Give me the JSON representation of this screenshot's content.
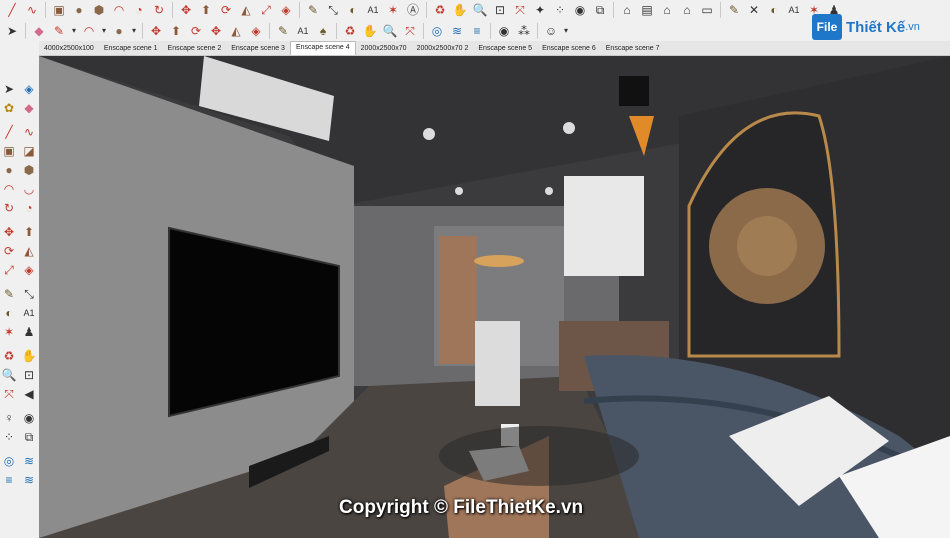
{
  "scene_tabs": [
    {
      "label": "4000x2500x100"
    },
    {
      "label": "Enscape scene 1"
    },
    {
      "label": "Enscape scene 2"
    },
    {
      "label": "Enscape scene 3"
    },
    {
      "label": "Enscape scene 4"
    },
    {
      "label": "2000x2500x70"
    },
    {
      "label": "2000x2500x70 2"
    },
    {
      "label": "Enscape scene 5"
    },
    {
      "label": "Enscape scene 6"
    },
    {
      "label": "Enscape scene 7"
    }
  ],
  "active_scene": "Enscape scene 4",
  "logo": {
    "mark": "File",
    "name": "Thiết Kế",
    "tld": ".vn"
  },
  "watermark": "Copyright © FileThietKe.vn",
  "colors": {
    "accent": "#1f77c9",
    "sketchup_red": "#c0392b",
    "wall": "#8c8c8c",
    "ceiling": "#333336",
    "floor": "#4a4541",
    "wood": "#a0765a"
  },
  "icons": {
    "toolbar_row1": [
      "line-icon",
      "freehand-icon",
      "rectangle-icon",
      "circle-icon",
      "polygon-icon",
      "arc-icon",
      "pie-icon",
      "move-icon",
      "pushpull-icon",
      "rotate-icon",
      "followme-icon",
      "scale-icon",
      "offset-icon",
      "tape-icon",
      "dimension-icon",
      "protractor-icon",
      "text-icon",
      "axes-icon",
      "3dtext-icon",
      "orbit-icon",
      "pan-icon",
      "zoom-icon",
      "zoom-window-icon",
      "zoom-extents-icon",
      "position-camera-icon",
      "walk-icon",
      "lookaround-icon",
      "section-icon",
      "warehouse-icon",
      "extension-icon",
      "home-icon",
      "house-icon",
      "component-icon",
      "paint-icon",
      "pencil-icon",
      "erase-icon",
      "chart-icon"
    ],
    "toolbar_row2": [
      "select-icon",
      "eraser-icon",
      "pencil-icon",
      "shape-icon",
      "arc-icon",
      "circle-icon",
      "polygon-icon",
      "rotate-icon",
      "move-icon",
      "pushpull-icon",
      "scale-icon",
      "followme-icon",
      "tape-icon",
      "text-icon",
      "paint-icon",
      "orbit-icon",
      "pan-icon",
      "zoom-icon",
      "zoom-extents-icon",
      "globe-icon",
      "layers-icon",
      "camera-icon",
      "walk-icon",
      "eye-icon",
      "footprint-icon",
      "user-icon"
    ],
    "left": [
      "select-icon",
      "3d-warehouse-icon",
      "paint-icon",
      "eraser-icon",
      "line-icon",
      "freehand-icon",
      "rectangle-icon",
      "rotated-rect-icon",
      "circle-icon",
      "polygon-icon",
      "arc-icon",
      "arc2-icon",
      "3pt-arc-icon",
      "pie-icon",
      "move-icon",
      "pushpull-icon",
      "rotate-icon",
      "followme-icon",
      "scale-icon",
      "offset-icon",
      "tape-icon",
      "dimension-icon",
      "protractor-icon",
      "text-icon",
      "axes-icon",
      "3dtext-icon",
      "orbit-icon",
      "pan-icon",
      "zoom-icon",
      "zoom-window-icon",
      "zoom-extents-icon",
      "previous-icon",
      "position-camera-icon",
      "lookaround-icon",
      "walk-icon",
      "section-icon",
      "globe-icon",
      "layers-icon",
      "styles-icon",
      "scenes-icon"
    ]
  }
}
